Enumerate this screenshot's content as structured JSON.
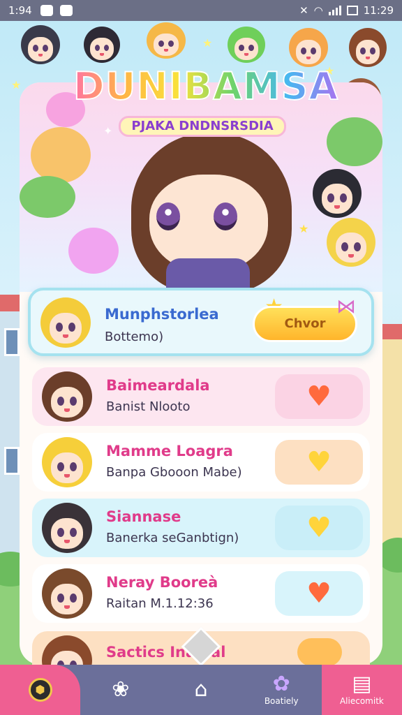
{
  "status_bar": {
    "time": "1:94",
    "clock_right": "11:29"
  },
  "header": {
    "title": "DUNIBAMSA",
    "subtitle": "PJAKA DNDNSRSDIA"
  },
  "list": [
    {
      "name": "Munphstorlea",
      "subtitle": "Bottemo)",
      "action_label": "Chvor",
      "bg": "#e9f8fc",
      "action_bg": "",
      "heart_color": ""
    },
    {
      "name": "Baimeardala",
      "subtitle": "Banist Nlooto",
      "action_label": "",
      "bg": "#fde6f0",
      "action_bg": "#fbd3e4",
      "heart_color": "#ff6a3d"
    },
    {
      "name": "Mamme Loagra",
      "subtitle": "Banpa Gbooon Mabe)",
      "action_label": "",
      "bg": "#ffffff",
      "action_bg": "#fde0c2",
      "heart_color": "#ffd43b"
    },
    {
      "name": "Siannase",
      "subtitle": "Banerka seGanbtign)",
      "action_label": "",
      "bg": "#d8f4fb",
      "action_bg": "#c9eef8",
      "heart_color": "#ffd43b"
    },
    {
      "name": "Neray Booreà",
      "subtitle": "Raitan M.1.12:36",
      "action_label": "",
      "bg": "#ffffff",
      "action_bg": "#d8f4fb",
      "heart_color": "#ff6a3d"
    },
    {
      "name": "Sactics Inamal",
      "subtitle": "",
      "action_label": "",
      "bg": "#fde0c2",
      "action_bg": "#ffbf5a",
      "heart_color": ""
    }
  ],
  "nav": [
    {
      "label": "",
      "icon": "badge-icon"
    },
    {
      "label": "",
      "icon": "paw-icon"
    },
    {
      "label": "",
      "icon": "home-icon"
    },
    {
      "label": "Boatiely",
      "icon": "toy-icon"
    },
    {
      "label": "Aliecomitk",
      "icon": "book-icon"
    }
  ],
  "colors": {
    "status_bar": "#6b6f86",
    "nav_bg": "#6b6f9a",
    "nav_active": "#ef5f92",
    "name_pink": "#e03b8a",
    "name_blue": "#3a6ad0"
  }
}
